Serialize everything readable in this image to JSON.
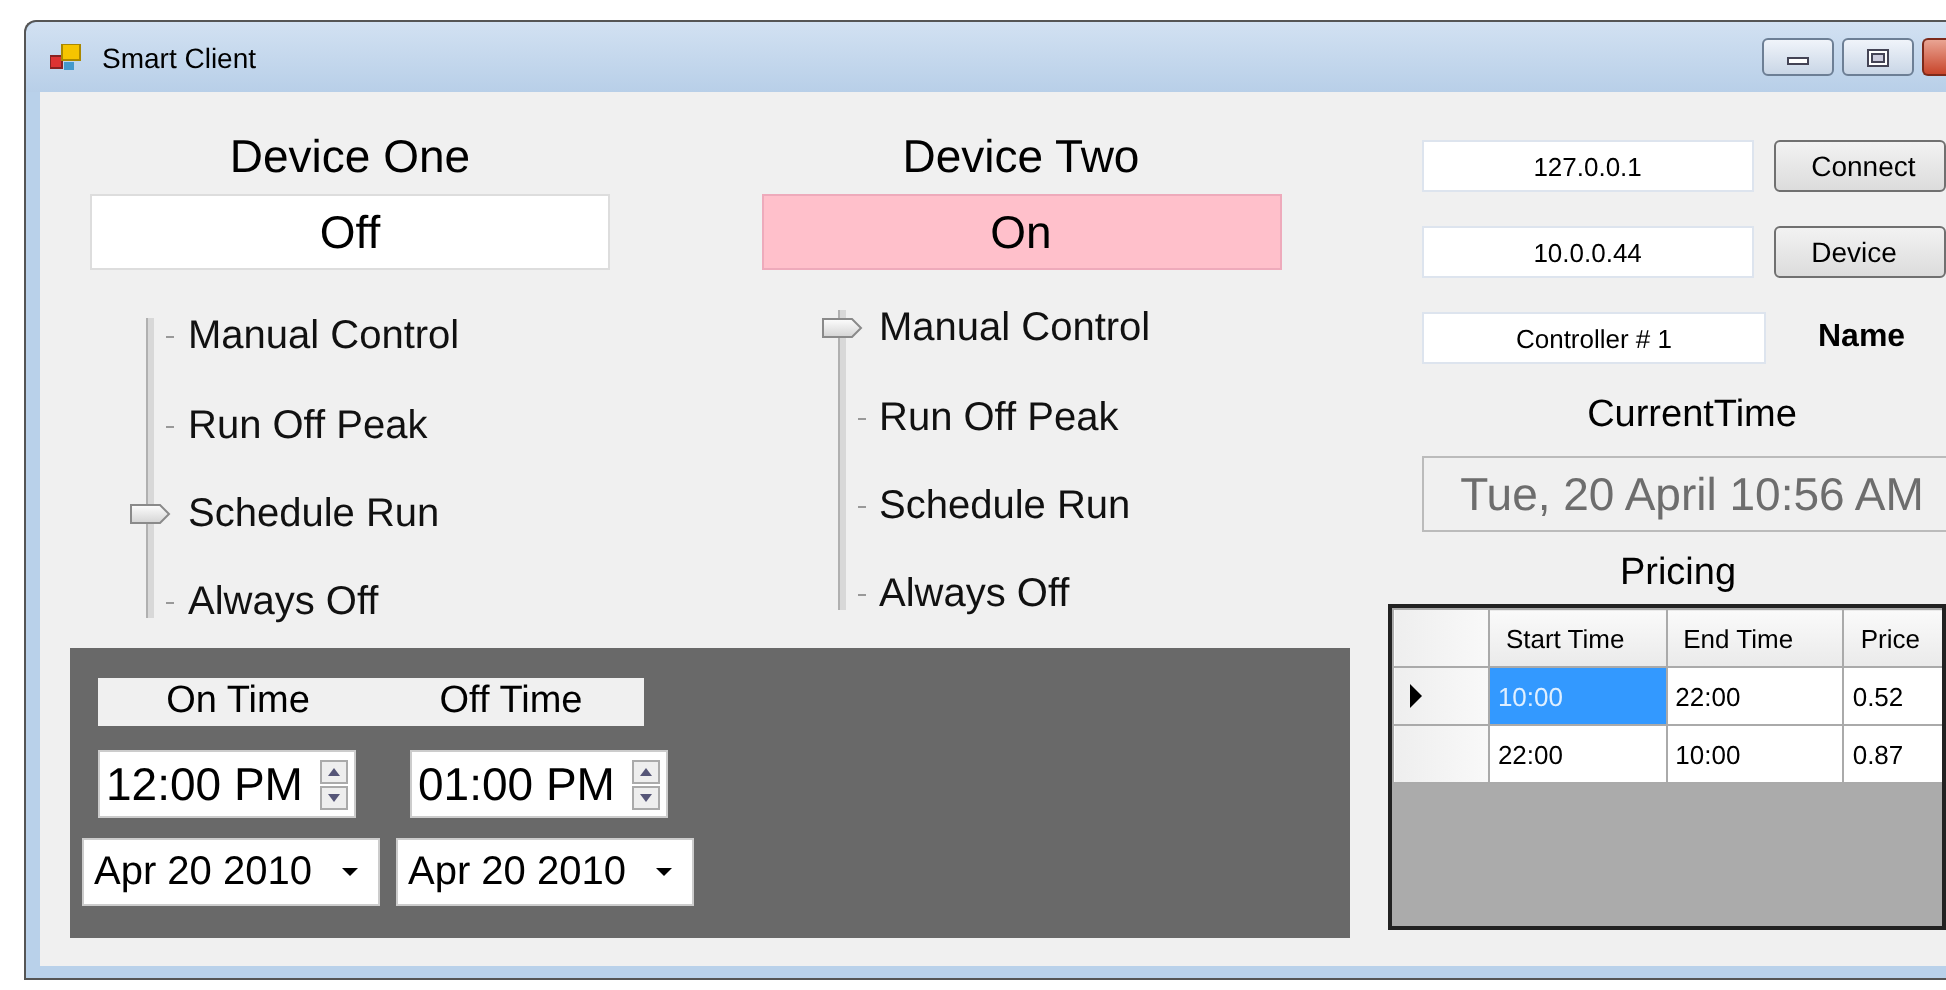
{
  "window": {
    "title": "Smart Client"
  },
  "devices": [
    {
      "title": "Device One",
      "status": {
        "text": "Off",
        "on": false
      },
      "modes": [
        {
          "label": "Manual Control",
          "selected": false
        },
        {
          "label": "Run Off Peak",
          "selected": false
        },
        {
          "label": "Schedule Run",
          "selected": true
        },
        {
          "label": "Always Off",
          "selected": false
        }
      ]
    },
    {
      "title": "Device Two",
      "status": {
        "text": "On",
        "on": true
      },
      "modes": [
        {
          "label": "Manual Control",
          "selected": true
        },
        {
          "label": "Run Off Peak",
          "selected": false
        },
        {
          "label": "Schedule Run",
          "selected": false
        },
        {
          "label": "Always Off",
          "selected": false
        }
      ]
    }
  ],
  "schedule": {
    "headings": [
      "On Time",
      "Off Time"
    ],
    "times": [
      "12:00 PM",
      "01:00 PM"
    ],
    "dates": [
      "Apr 20 2010",
      "Apr 20 2010"
    ]
  },
  "connection": {
    "address": "127.0.0.1",
    "connect_button": "Connect",
    "device_address": "10.0.0.44",
    "device_button": "Device",
    "name_value": "Controller # 1",
    "name_label": "Name"
  },
  "current_time": {
    "label": "CurrentTime",
    "value": "Tue, 20 April 10:56 AM"
  },
  "pricing": {
    "title": "Pricing",
    "columns": [
      "Start Time",
      "End Time",
      "Price"
    ],
    "rows": [
      {
        "current": true,
        "cells": [
          {
            "text": "10:00",
            "selected": true
          },
          {
            "text": "22:00",
            "selected": false
          },
          {
            "text": "0.52",
            "selected": false
          }
        ]
      },
      {
        "current": false,
        "cells": [
          {
            "text": "22:00",
            "selected": false
          },
          {
            "text": "10:00",
            "selected": false
          },
          {
            "text": "0.87",
            "selected": false
          }
        ]
      }
    ]
  }
}
